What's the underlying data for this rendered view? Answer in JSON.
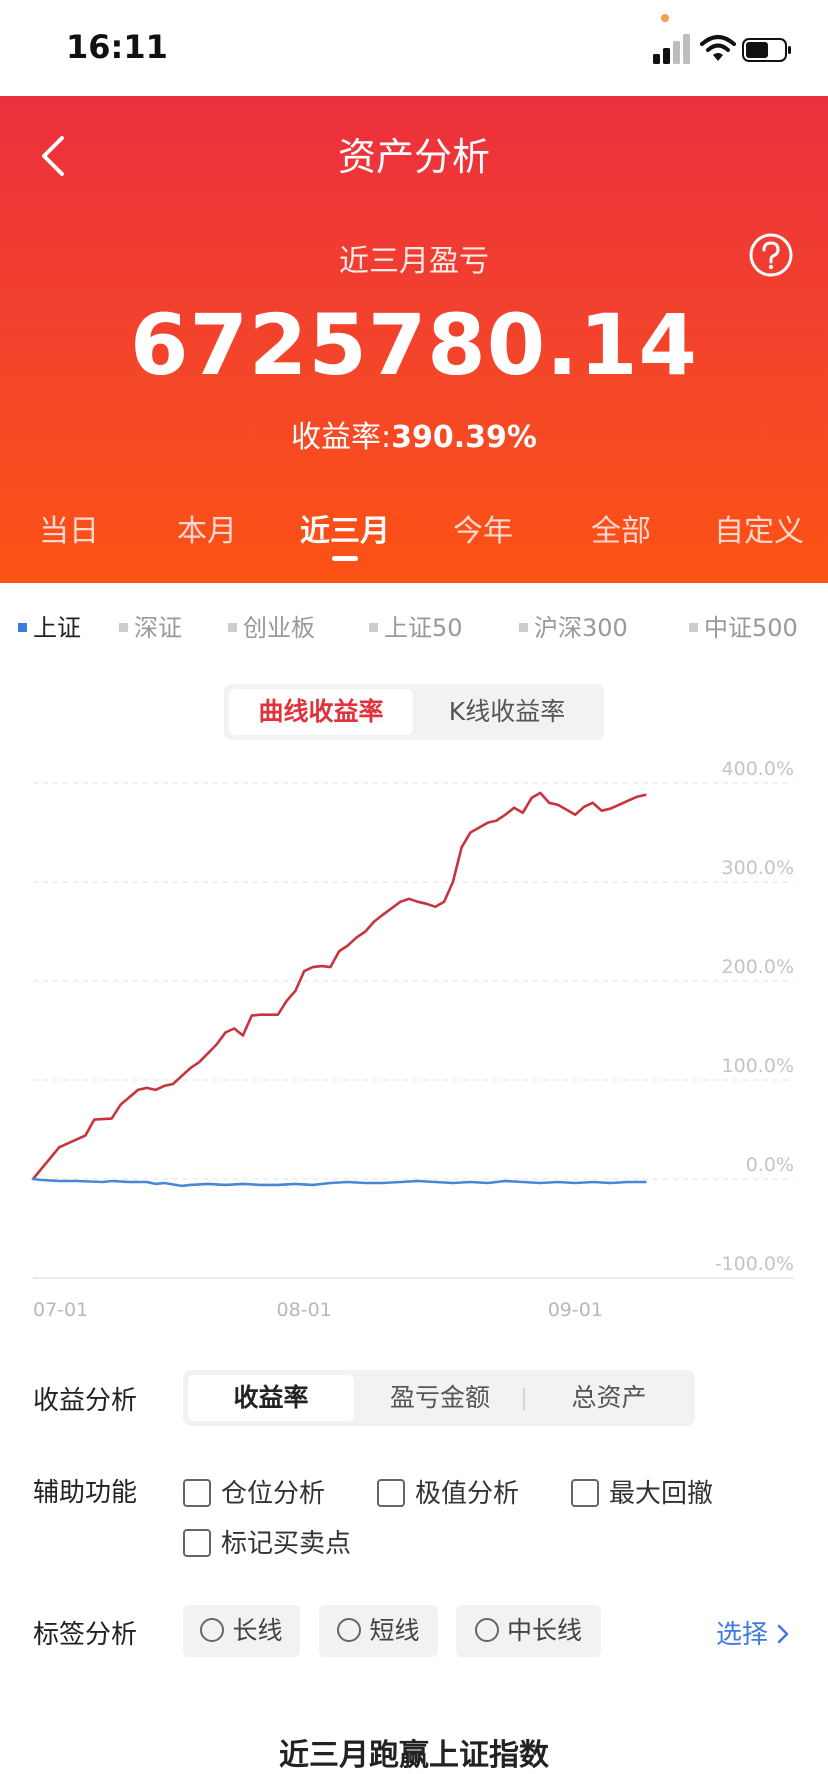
{
  "status_bar": {
    "time": "16:11"
  },
  "header": {
    "title": "资产分析"
  },
  "summary": {
    "period_label": "近三月盈亏",
    "amount": "6725780.14",
    "yield_label": "收益率:",
    "yield_value": "390.39%"
  },
  "period_tabs": [
    {
      "label": "当日",
      "active": false
    },
    {
      "label": "本月",
      "active": false
    },
    {
      "label": "近三月",
      "active": true
    },
    {
      "label": "今年",
      "active": false
    },
    {
      "label": "全部",
      "active": false
    },
    {
      "label": "自定义",
      "active": false
    }
  ],
  "index_tabs": [
    {
      "label": "上证",
      "active": true
    },
    {
      "label": "深证",
      "active": false
    },
    {
      "label": "创业板",
      "active": false
    },
    {
      "label": "上证50",
      "active": false
    },
    {
      "label": "沪深300",
      "active": false
    },
    {
      "label": "中证500",
      "active": false
    }
  ],
  "chart_toggle": {
    "curve_label": "曲线收益率",
    "kline_label": "K线收益率",
    "active": "curve"
  },
  "colors": {
    "accent_red": "#e0323c",
    "index_blue": "#3d7be0",
    "strategy_line": "#c9333e",
    "index_line": "#4a86d8"
  },
  "chart_data": {
    "type": "line",
    "x_ticks": [
      "07-01",
      "08-01",
      "09-01"
    ],
    "y_ticks": [
      "400.0%",
      "300.0%",
      "200.0%",
      "100.0%",
      "0.0%",
      "-100.0%"
    ],
    "ylim": [
      -100,
      400
    ],
    "x_range": [
      1,
      72
    ],
    "grid": true,
    "series": [
      {
        "x": [
          1,
          4,
          7,
          8,
          10,
          11,
          13,
          14,
          15,
          16,
          17,
          18,
          19,
          20,
          22,
          23,
          24,
          25,
          26,
          27,
          29,
          30,
          31,
          32,
          33,
          34,
          35,
          36,
          37,
          38,
          39,
          40,
          41,
          43,
          44,
          45,
          46,
          47,
          48,
          49,
          50,
          51,
          52,
          53,
          54,
          55,
          56,
          57,
          58,
          59,
          60,
          61,
          62,
          63,
          64,
          65,
          66,
          67,
          68,
          69,
          70,
          71
        ],
        "values": [
          0,
          32,
          44,
          60,
          61,
          75,
          90,
          92,
          90,
          94,
          96,
          104,
          112,
          118,
          136,
          148,
          152,
          145,
          165,
          166,
          166,
          180,
          190,
          210,
          214,
          215,
          214,
          230,
          236,
          244,
          250,
          260,
          267,
          280,
          283,
          280,
          278,
          275,
          280,
          300,
          335,
          350,
          355,
          360,
          362,
          368,
          375,
          370,
          385,
          390,
          380,
          378,
          373,
          368,
          376,
          380,
          372,
          374,
          378,
          382,
          386,
          388
        ]
      },
      {
        "x": [
          1,
          2,
          4,
          6,
          9,
          10,
          12,
          14,
          15,
          16,
          18,
          19,
          21,
          23,
          25,
          27,
          29,
          31,
          33,
          35,
          37,
          39,
          41,
          43,
          45,
          47,
          49,
          51,
          53,
          55,
          57,
          59,
          61,
          63,
          65,
          67,
          69,
          71
        ],
        "values": [
          0,
          -1,
          -2,
          -2,
          -3,
          -2,
          -3,
          -3,
          -5,
          -4,
          -7,
          -6,
          -5,
          -6,
          -5,
          -6,
          -6,
          -5,
          -6,
          -4,
          -3,
          -4,
          -4,
          -3,
          -2,
          -3,
          -4,
          -3,
          -4,
          -2,
          -3,
          -4,
          -3,
          -4,
          -3,
          -4,
          -3,
          -3
        ]
      }
    ]
  },
  "analysis": {
    "label": "收益分析",
    "options": [
      {
        "label": "收益率",
        "active": true
      },
      {
        "label": "盈亏金额",
        "active": false
      },
      {
        "label": "总资产",
        "active": false
      }
    ]
  },
  "aux": {
    "label": "辅助功能",
    "options": [
      "仓位分析",
      "极值分析",
      "最大回撤",
      "标记买卖点"
    ]
  },
  "tags": {
    "label": "标签分析",
    "options": [
      "长线",
      "短线",
      "中长线"
    ],
    "select_label": "选择"
  },
  "footer": {
    "title": "近三月跑赢上证指数"
  }
}
